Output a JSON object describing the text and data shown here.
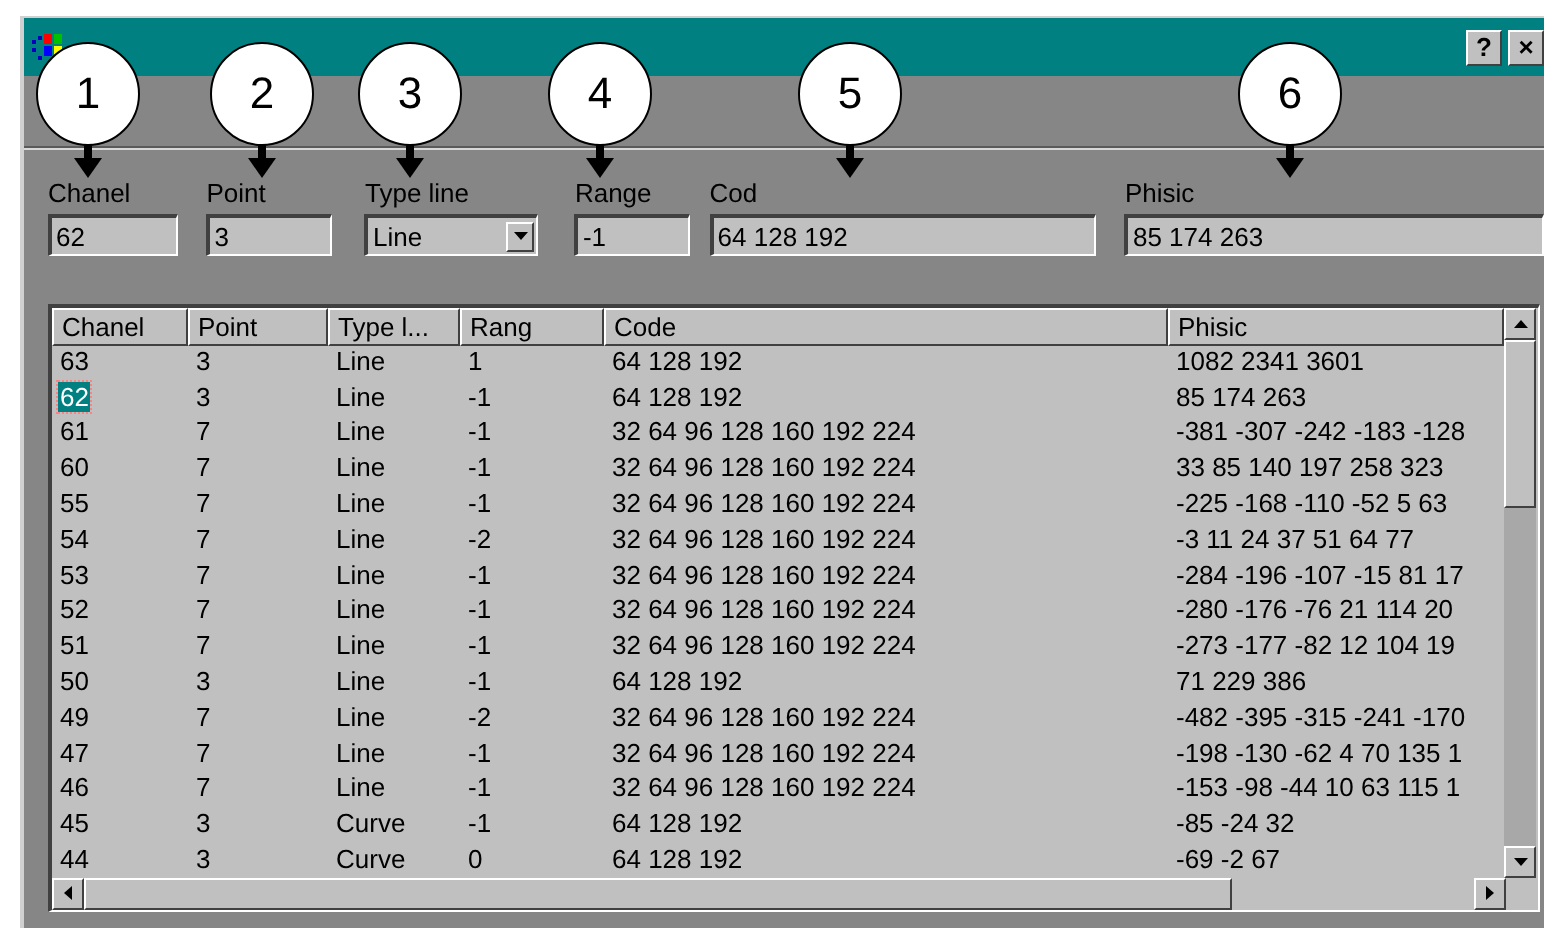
{
  "window": {
    "title_buttons": [
      "?",
      "×"
    ]
  },
  "callouts": [
    {
      "label": "1"
    },
    {
      "label": "2"
    },
    {
      "label": "3"
    },
    {
      "label": "4"
    },
    {
      "label": "5"
    },
    {
      "label": "6"
    }
  ],
  "fields": [
    {
      "kind": "text",
      "label": "Chanel",
      "value": "62"
    },
    {
      "kind": "text",
      "label": "Point",
      "value": "3"
    },
    {
      "kind": "dropdown",
      "label": "Type line",
      "value": "Line"
    },
    {
      "kind": "text",
      "label": "Range",
      "value": "-1"
    },
    {
      "kind": "text",
      "label": "Cod",
      "value": "64 128 192"
    },
    {
      "kind": "text",
      "label": "Phisic",
      "value": "85 174 263"
    }
  ],
  "table": {
    "columns": [
      "Chanel",
      "Point",
      "Type l...",
      "Rang",
      "Code",
      "Phisic"
    ],
    "rows": [
      {
        "selected": false,
        "cells": [
          "63",
          "3",
          "Line",
          "1",
          "64 128 192",
          "1082 2341 3601"
        ]
      },
      {
        "selected": true,
        "cells": [
          "62",
          "3",
          "Line",
          "-1",
          "64 128 192",
          "85 174 263"
        ]
      },
      {
        "selected": false,
        "cells": [
          "61",
          "7",
          "Line",
          "-1",
          "32 64 96 128 160 192 224",
          "-381 -307 -242 -183 -128"
        ]
      },
      {
        "selected": false,
        "cells": [
          "60",
          "7",
          "Line",
          "-1",
          "32 64 96 128 160 192 224",
          "33 85 140 197 258 323"
        ]
      },
      {
        "selected": false,
        "cells": [
          "55",
          "7",
          "Line",
          "-1",
          "32 64 96 128 160 192 224",
          "-225 -168 -110 -52 5 63"
        ]
      },
      {
        "selected": false,
        "cells": [
          "54",
          "7",
          "Line",
          "-2",
          "32 64 96 128 160 192 224",
          "-3 11 24 37 51 64 77"
        ]
      },
      {
        "selected": false,
        "cells": [
          "53",
          "7",
          "Line",
          "-1",
          "32 64 96 128 160 192 224",
          "-284 -196 -107 -15 81 17"
        ]
      },
      {
        "selected": false,
        "cells": [
          "52",
          "7",
          "Line",
          "-1",
          "32 64 96 128 160 192 224",
          "-280 -176 -76 21 114 20"
        ]
      },
      {
        "selected": false,
        "cells": [
          "51",
          "7",
          "Line",
          "-1",
          "32 64 96 128 160 192 224",
          "-273 -177 -82 12 104 19"
        ]
      },
      {
        "selected": false,
        "cells": [
          "50",
          "3",
          "Line",
          "-1",
          "64 128 192",
          "71 229 386"
        ]
      },
      {
        "selected": false,
        "cells": [
          "49",
          "7",
          "Line",
          "-2",
          "32 64 96 128 160 192 224",
          "-482 -395 -315 -241 -170"
        ]
      },
      {
        "selected": false,
        "cells": [
          "47",
          "7",
          "Line",
          "-1",
          "32 64 96 128 160 192 224",
          "-198 -130 -62 4 70 135 1"
        ]
      },
      {
        "selected": false,
        "cells": [
          "46",
          "7",
          "Line",
          "-1",
          "32 64 96 128 160 192 224",
          "-153 -98 -44 10 63 115 1"
        ]
      },
      {
        "selected": false,
        "cells": [
          "45",
          "3",
          "Curve",
          "-1",
          "64 128 192",
          "-85 -24 32"
        ]
      },
      {
        "selected": false,
        "cells": [
          "44",
          "3",
          "Curve",
          "0",
          "64 128 192",
          "-69 -2 67"
        ]
      }
    ]
  }
}
